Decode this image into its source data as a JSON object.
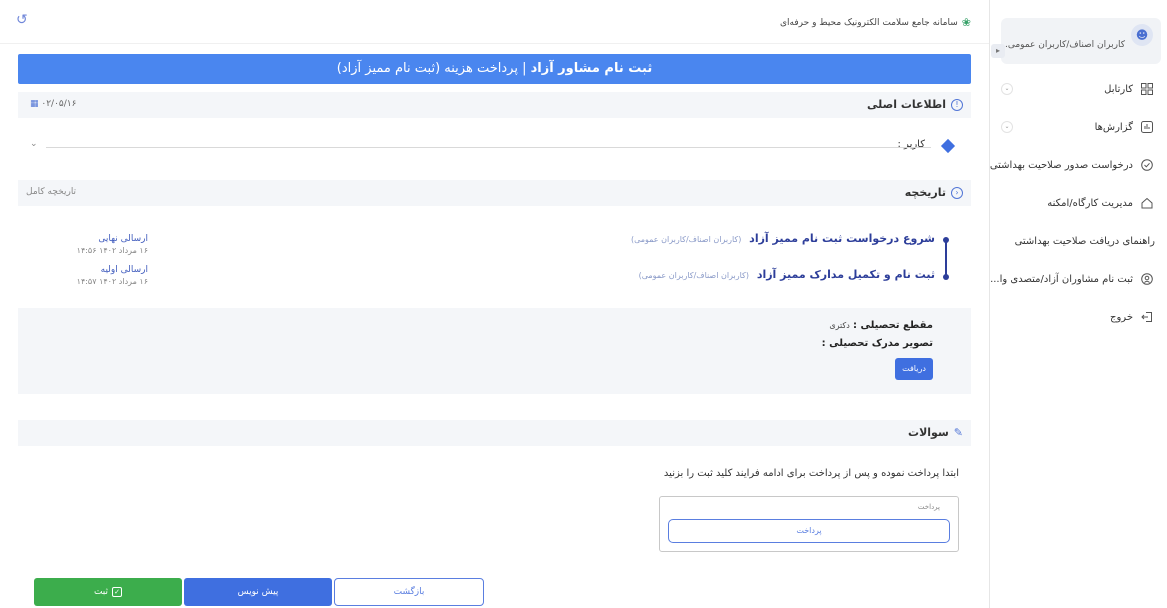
{
  "sidebar": {
    "user_name": "کاربران اصناف/کاربران عمومی...",
    "items": [
      {
        "label": "کارتابل",
        "icon": "grid-icon",
        "has_chevron": true
      },
      {
        "label": "گزارش‌ها",
        "icon": "chart-icon",
        "has_chevron": true
      },
      {
        "label": "درخواست صدور صلاحیت بهداشتی",
        "icon": "check-circle-icon",
        "has_chevron": false
      },
      {
        "label": "مدیریت کارگاه/امکنه",
        "icon": "home-icon",
        "has_chevron": false
      },
      {
        "label": "راهنمای دریافت صلاحیت بهداشتی",
        "icon": "",
        "has_chevron": false
      },
      {
        "label": "ثبت نام مشاوران آزاد/متصدی وا...",
        "icon": "badge-icon",
        "has_chevron": false
      },
      {
        "label": "خروج",
        "icon": "logout-icon",
        "has_chevron": false
      }
    ]
  },
  "topbar": {
    "title": "سامانه جامع سلامت الکترونیک محیط و حرفه‌ای"
  },
  "banner": {
    "bold": "ثبت نام مشاور آزاد",
    "separator": " | ",
    "rest": "پرداخت هزینه (ثبت نام ممیز آزاد)"
  },
  "main_info": {
    "title": "اطلاعات اصلی",
    "date": "۰۲/۰۵/۱۶",
    "user_label": "کاربر :"
  },
  "history": {
    "title": "تاریخچه",
    "full_link": "تاریخچه کامل",
    "timeline": [
      {
        "title": "شروع درخواست ثبت نام ممیز آزاد",
        "sub": "(کاربران اصناف/کاربران عمومی)"
      },
      {
        "title": "ثبت نام و تکمیل مدارک ممیز آزاد",
        "sub": "(کاربران اصناف/کاربران عمومی)"
      }
    ],
    "events": [
      {
        "title": "ارسالی نهایی",
        "date": "۱۶ مرداد ۱۴۰۲ ۱۴:۵۶"
      },
      {
        "title": "ارسالی اولیه",
        "date": "۱۶ مرداد ۱۴۰۲ ۱۴:۵۷"
      }
    ]
  },
  "details": {
    "degree_label": "مقطع تحصیلی :",
    "degree_value": "دکتری",
    "image_label": "تصویر مدرک تحصیلی :",
    "download_label": "دریافت"
  },
  "questions": {
    "title": "سوالات",
    "instruction": "ابتدا پرداخت نموده و پس از پرداخت برای ادامه فرایند کلید ثبت را بزنید",
    "pay_box_label": "پرداخت",
    "pay_button": "پرداخت"
  },
  "actions": {
    "submit": "ثبت",
    "draft": "پیش نویس",
    "back": "بازگشت"
  },
  "colors": {
    "primary": "#3f6fe0",
    "banner": "#4a86ef",
    "success": "#3cad4c"
  }
}
